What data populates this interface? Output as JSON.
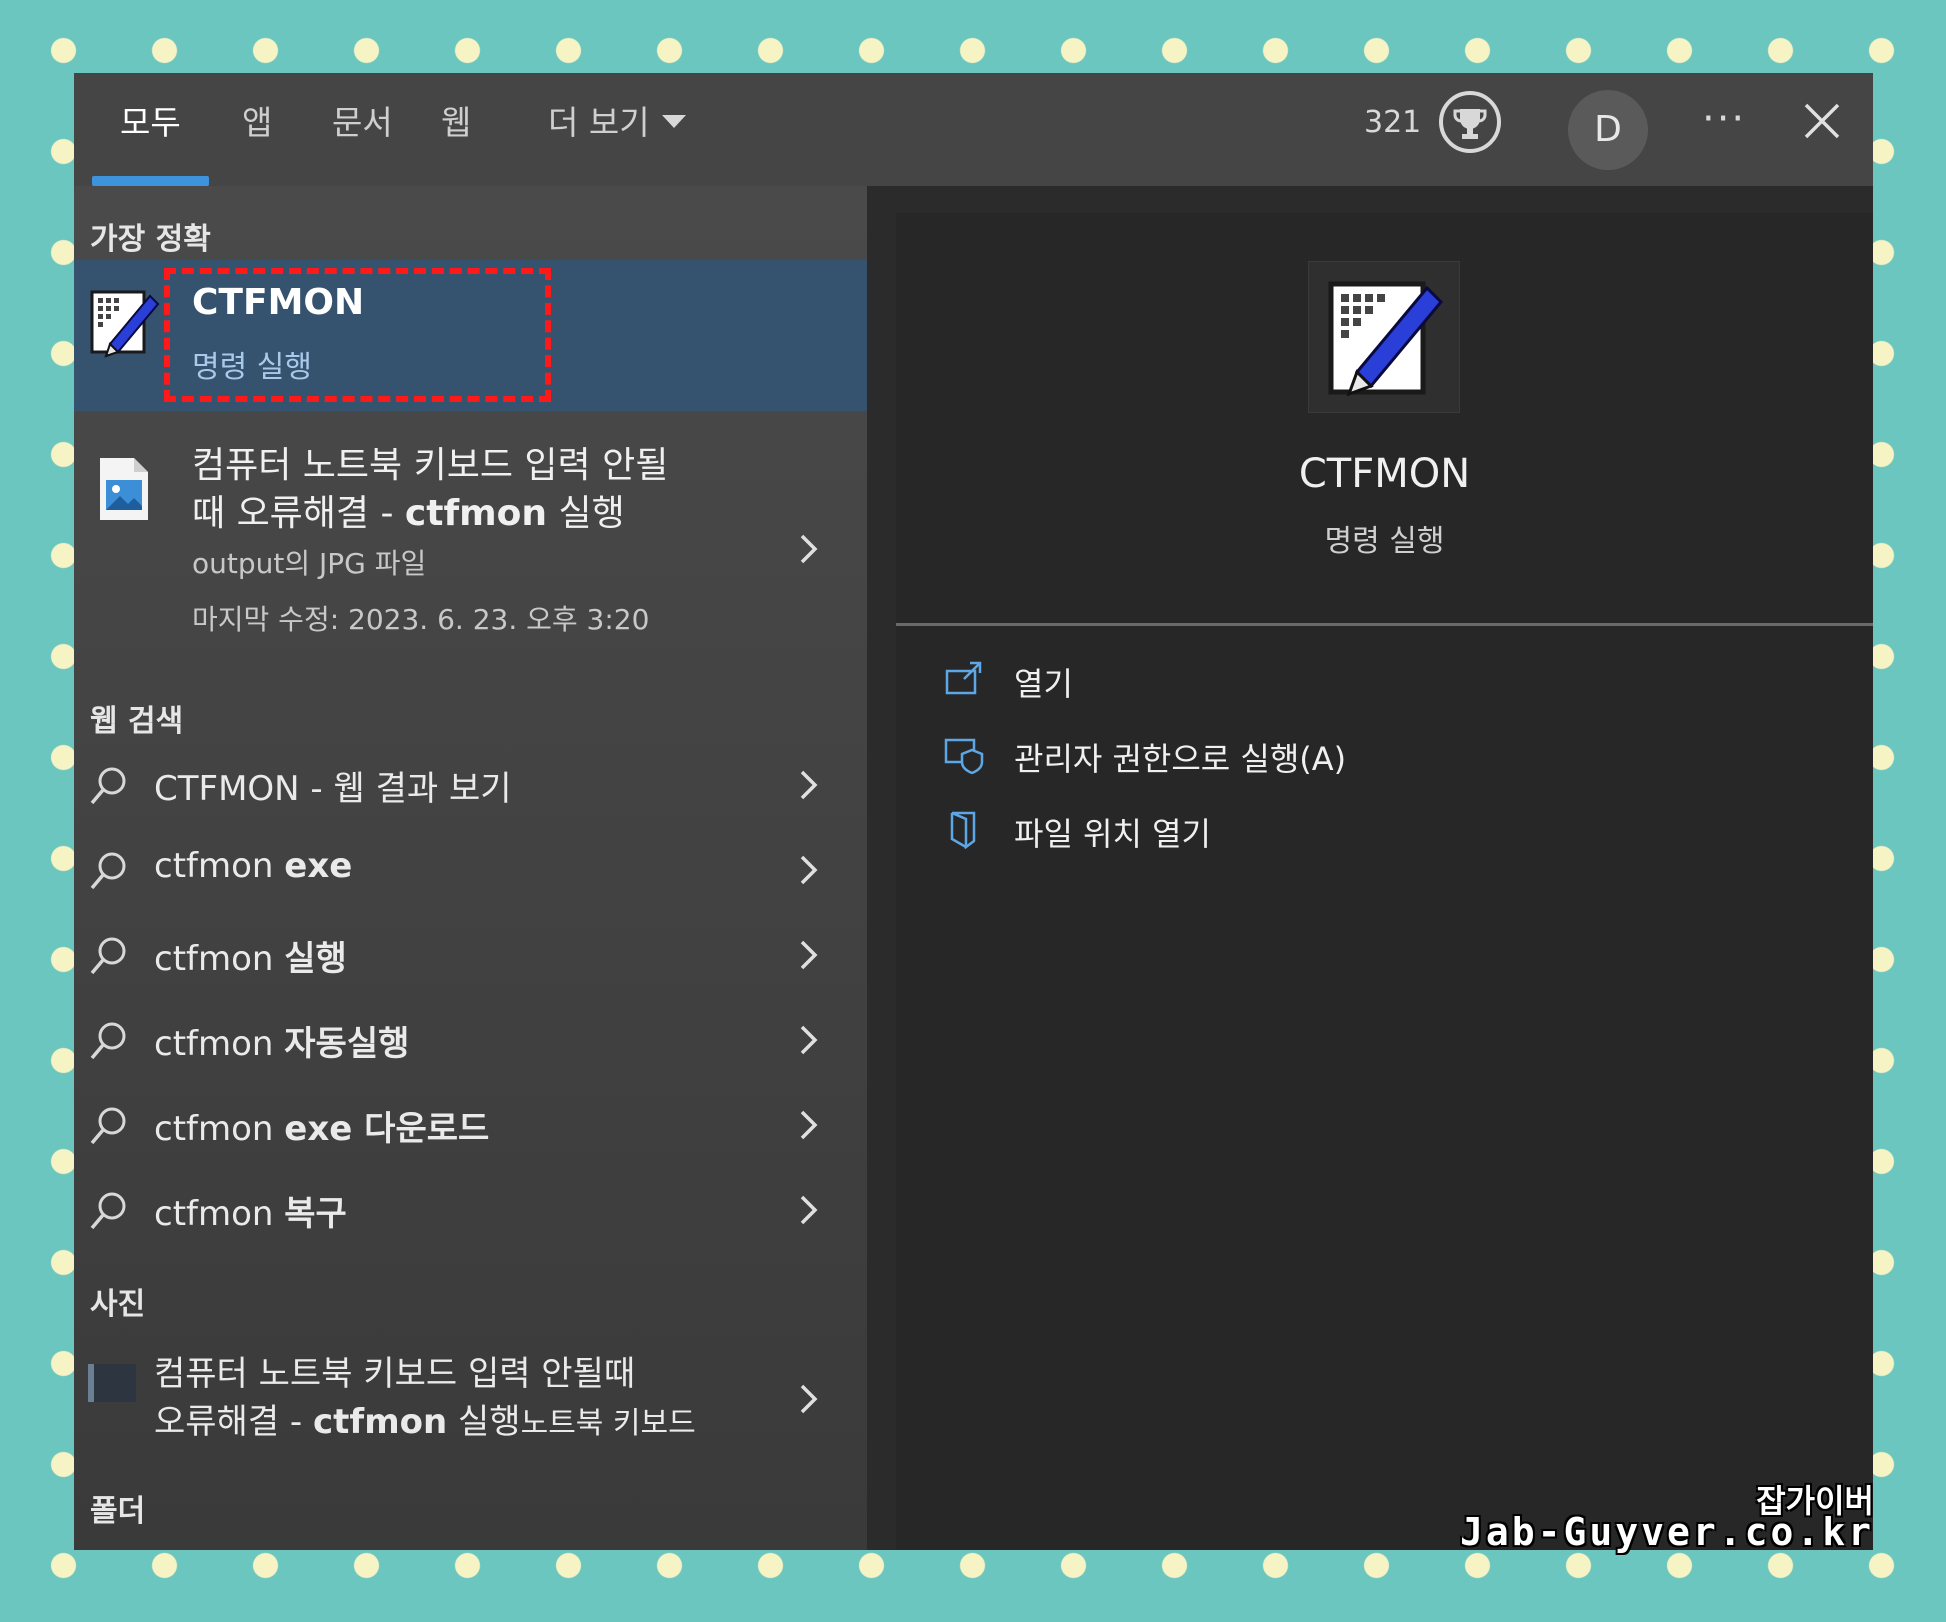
{
  "tabs": [
    {
      "label": "모두"
    },
    {
      "label": "앱"
    },
    {
      "label": "문서"
    },
    {
      "label": "웹"
    },
    {
      "label": "더 보기"
    }
  ],
  "header": {
    "points": "321",
    "avatar_initial": "D",
    "more_label": "···"
  },
  "best_match": {
    "section_title": "가장 정확",
    "title": "CTFMON",
    "subtitle": "명령 실행"
  },
  "document_result": {
    "line1": "컴퓨터 노트북 키보드 입력 안될",
    "line2_prefix": "때 오류해결 - ",
    "line2_bold": "ctfmon",
    "line2_suffix": " 실행",
    "meta1": "output의 JPG 파일",
    "meta2": "마지막 수정: 2023. 6. 23. 오후 3:20"
  },
  "web_search": {
    "section_title": "웹 검색",
    "items": [
      {
        "plain": "CTFMON",
        "bold": "",
        "rest": " - 웹 결과 보기"
      },
      {
        "plain": "ctfmon ",
        "bold": "exe",
        "rest": ""
      },
      {
        "plain": "ctfmon ",
        "bold": "실행",
        "rest": ""
      },
      {
        "plain": "ctfmon ",
        "bold": "자동실행",
        "rest": ""
      },
      {
        "plain": "ctfmon ",
        "bold": "exe 다운로드",
        "rest": ""
      },
      {
        "plain": "ctfmon ",
        "bold": "복구",
        "rest": ""
      }
    ]
  },
  "photos": {
    "section_title": "사진",
    "line1": "컴퓨터 노트북 키보드 입력 안될때",
    "line2_prefix": "오류해결 - ",
    "line2_bold": "ctfmon",
    "line2_suffix": " 실행",
    "line2_extra": "노트북 키보드"
  },
  "folders": {
    "section_title": "폴더"
  },
  "detail": {
    "title": "CTFMON",
    "subtitle": "명령 실행",
    "actions": [
      {
        "label": "열기",
        "icon": "open-icon"
      },
      {
        "label": "관리자 권한으로 실행(A)",
        "icon": "shield-icon"
      },
      {
        "label": "파일 위치 열기",
        "icon": "folder-location-icon"
      }
    ]
  },
  "watermark": {
    "line1": "잡가이버",
    "line2": "Jab-Guyver.co.kr"
  },
  "colors": {
    "accent": "#3e94dc",
    "selection": "#35526e",
    "highlight_box": "#ff1a1a",
    "background": "#6cc6c0"
  }
}
